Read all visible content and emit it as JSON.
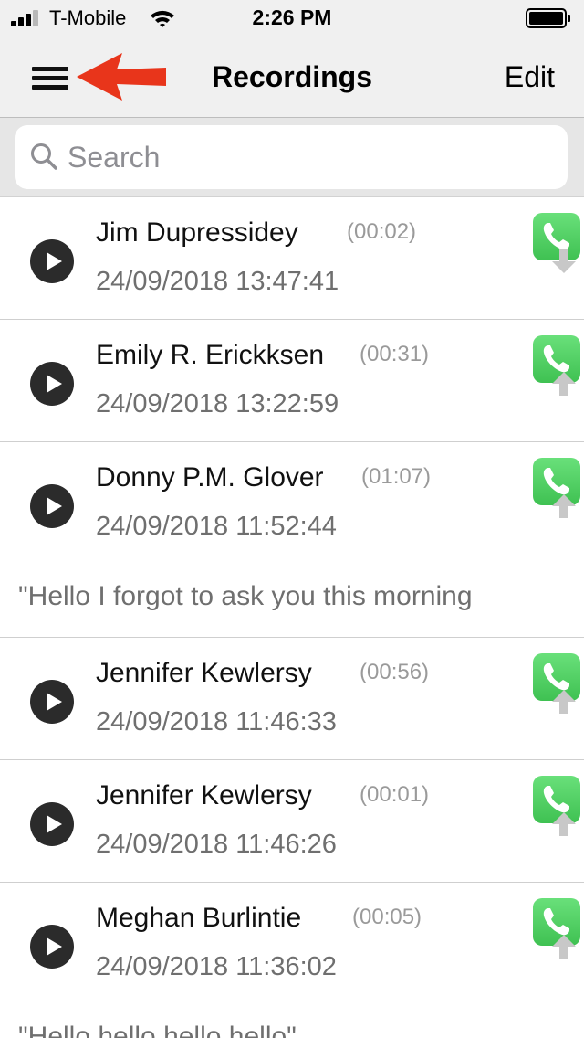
{
  "status_bar": {
    "carrier": "T-Mobile",
    "time": "2:26 PM"
  },
  "nav": {
    "title": "Recordings",
    "edit_label": "Edit"
  },
  "search": {
    "placeholder": "Search"
  },
  "colors": {
    "accent_annotation": "#e8351b",
    "call_green": "#4cd964",
    "play_button": "#2b2b2b"
  },
  "recordings": [
    {
      "name": "Jim Dupressidey",
      "duration": "(00:02)",
      "timestamp": "24/09/2018 13:47:41",
      "direction": "down",
      "note": ""
    },
    {
      "name": "Emily R. Erickksen",
      "duration": "(00:31)",
      "timestamp": "24/09/2018 13:22:59",
      "direction": "up",
      "note": ""
    },
    {
      "name": "Donny P.M. Glover",
      "duration": "(01:07)",
      "timestamp": "24/09/2018 11:52:44",
      "direction": "up",
      "note": "\"Hello I forgot to ask you this morning"
    },
    {
      "name": "Jennifer Kewlersy",
      "duration": "(00:56)",
      "timestamp": "24/09/2018 11:46:33",
      "direction": "up",
      "note": ""
    },
    {
      "name": "Jennifer Kewlersy",
      "duration": "(00:01)",
      "timestamp": "24/09/2018 11:46:26",
      "direction": "up",
      "note": ""
    },
    {
      "name": "Meghan Burlintie",
      "duration": "(00:05)",
      "timestamp": "24/09/2018 11:36:02",
      "direction": "up",
      "note": "\"Hello hello hello hello\""
    }
  ]
}
